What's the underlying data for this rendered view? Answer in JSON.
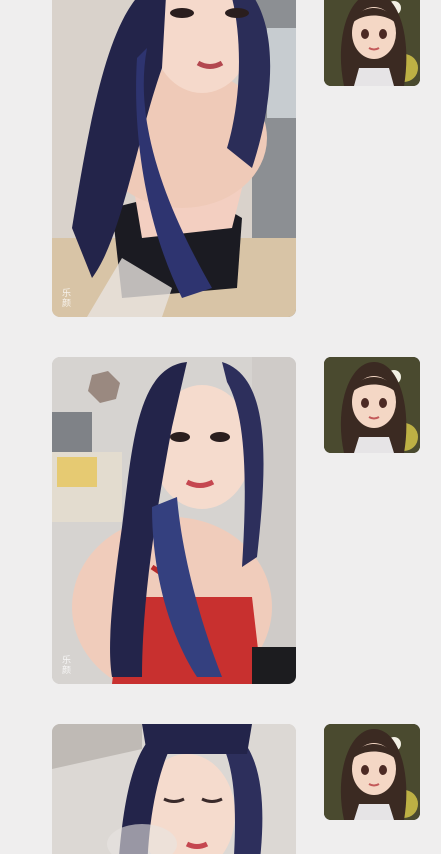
{
  "colors": {
    "background": "#efeeee",
    "hair": "#23244a",
    "hair_highlight": "#3a3f7a",
    "skin": "#f3d6c8",
    "top_red": "#c8302f",
    "top_pink": "#f4d2c4"
  },
  "posts": [
    {
      "watermark": "乐\n颜",
      "avatar_icon": "anime-girl-avatar-icon"
    },
    {
      "watermark": "乐\n颜",
      "avatar_icon": "anime-girl-avatar-icon"
    },
    {
      "watermark": "",
      "avatar_icon": "anime-girl-avatar-icon"
    }
  ]
}
